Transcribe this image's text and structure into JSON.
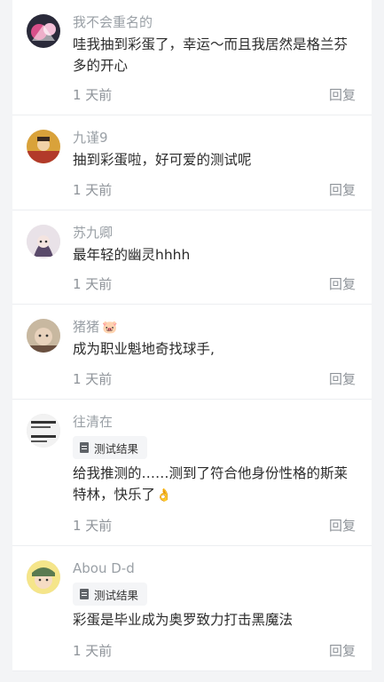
{
  "comments": [
    {
      "username": "我不会重名的",
      "text": "哇我抽到彩蛋了，幸运～而且我居然是格兰芬多的开心",
      "time": "1 天前",
      "reply": "回复",
      "avatar_colors": [
        "#2a2a3a",
        "#d94f8a"
      ]
    },
    {
      "username": "九谨9",
      "text": "抽到彩蛋啦，好可爱的测试呢",
      "time": "1 天前",
      "reply": "回复",
      "avatar_colors": [
        "#d9a23a",
        "#b23a2a"
      ]
    },
    {
      "username": "苏九卿",
      "text": "最年轻的幽灵hhhh",
      "time": "1 天前",
      "reply": "回复",
      "avatar_colors": [
        "#e9e2e8",
        "#5a4a6a"
      ]
    },
    {
      "username": "猪猪",
      "username_icon": "🐷",
      "text": "成为职业魁地奇找球手,",
      "time": "1 天前",
      "reply": "回复",
      "avatar_colors": [
        "#c8b8a0",
        "#6a5040"
      ]
    },
    {
      "username": "往清在",
      "tag": "测试结果",
      "text": "给我推测的……测到了符合他身份性格的斯莱特林，快乐了",
      "text_icon": "👌",
      "time": "1 天前",
      "reply": "回复",
      "avatar_colors": [
        "#f2f2f2",
        "#333333"
      ]
    },
    {
      "username": "Abou D-d",
      "tag": "测试结果",
      "text": "彩蛋是毕业成为奥罗致力打击黑魔法",
      "time": "1 天前",
      "reply": "回复",
      "avatar_colors": [
        "#f5e58a",
        "#5a7a50"
      ]
    }
  ]
}
